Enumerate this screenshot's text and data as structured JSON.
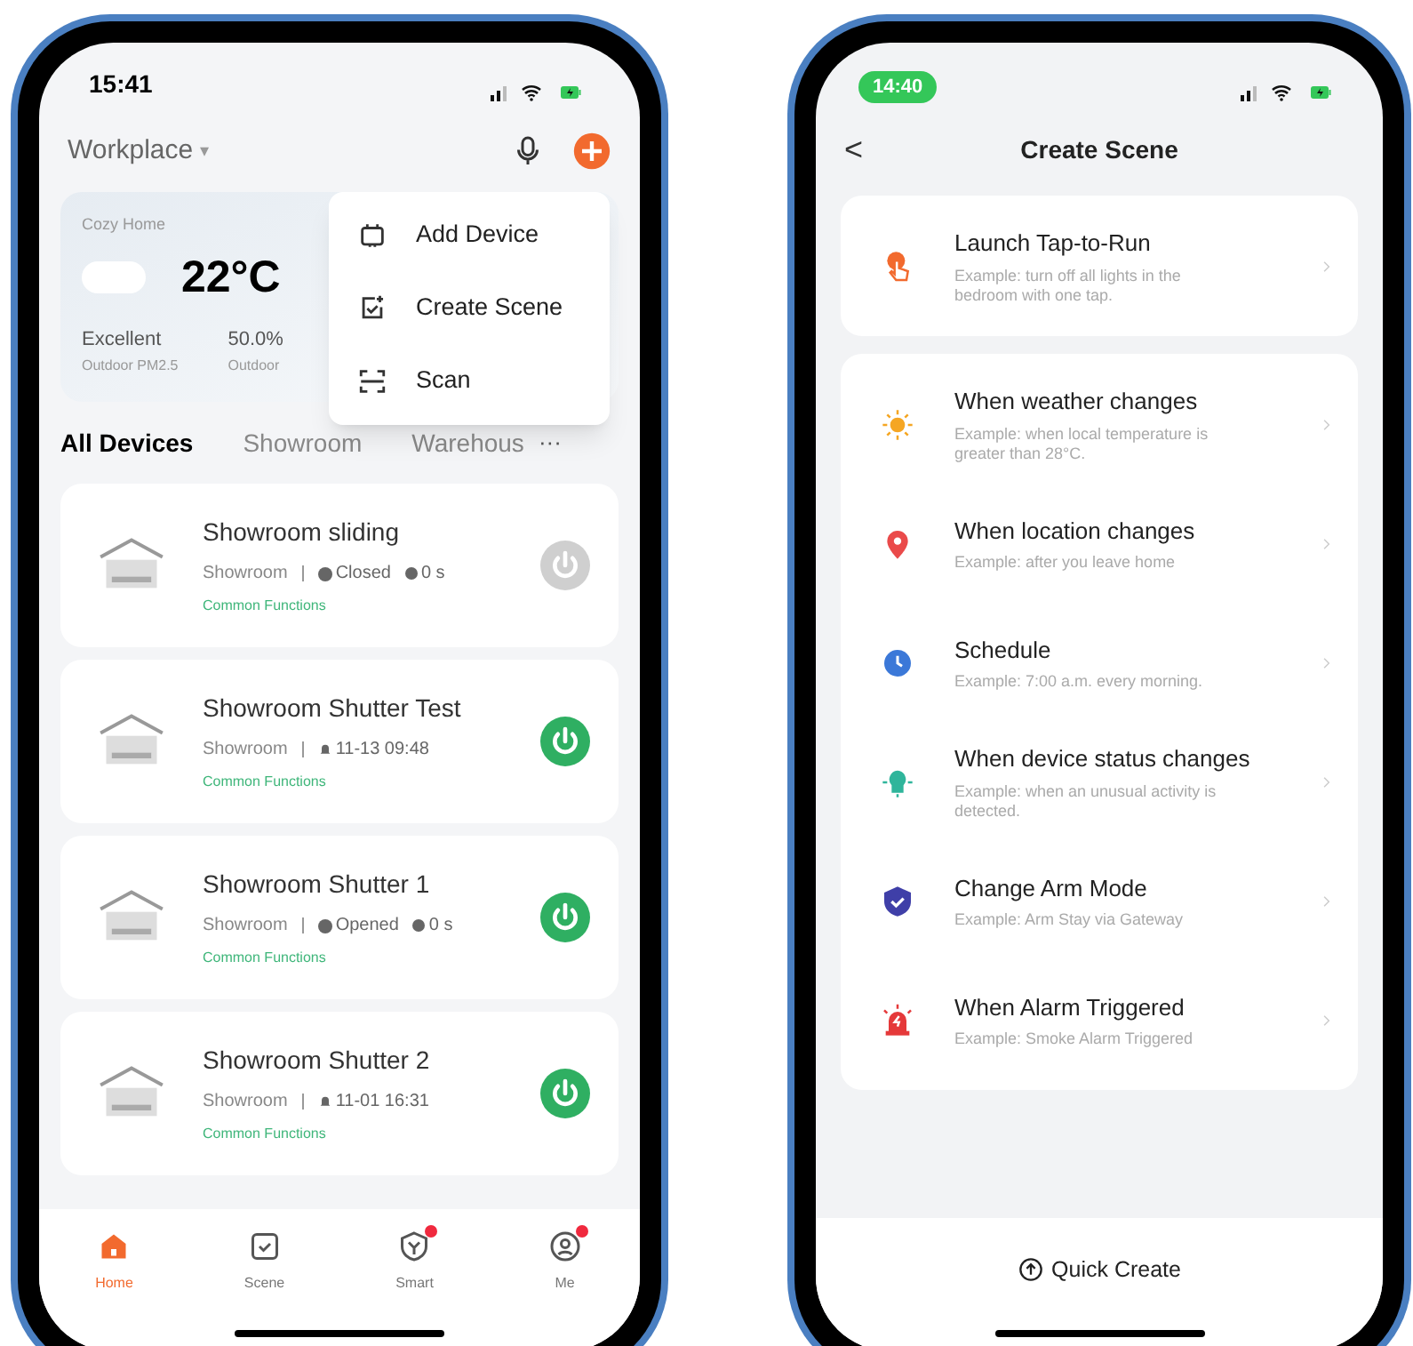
{
  "home_screen": {
    "status_bar": {
      "time": "15:41"
    },
    "header": {
      "title": "Workplace",
      "caret": "▾"
    },
    "weather": {
      "home": "Cozy Home",
      "temperature": "22°C",
      "stats": [
        {
          "value": "Excellent",
          "label": "Outdoor PM2.5"
        },
        {
          "value": "50.0%",
          "label": "Outdoor"
        }
      ]
    },
    "menu": {
      "items": [
        {
          "kind": "device",
          "label": "Add Device"
        },
        {
          "kind": "scene",
          "label": "Create Scene"
        },
        {
          "kind": "scan",
          "label": "Scan"
        }
      ]
    },
    "tabs": [
      {
        "label": "All Devices",
        "selected": true
      },
      {
        "label": "Showroom",
        "selected": false
      },
      {
        "label": "Warehous",
        "selected": false
      }
    ],
    "tabs_more": "···",
    "devices": [
      {
        "name": "Showroom sliding",
        "room": "Showroom",
        "status": "Closed",
        "duration": "0 s",
        "functions": "Common Functions",
        "on": false
      },
      {
        "name": "Showroom Shutter Test",
        "room": "Showroom",
        "timestamp": "11-13 09:48",
        "functions": "Common Functions",
        "on": true
      },
      {
        "name": "Showroom Shutter 1",
        "room": "Showroom",
        "status": "Opened",
        "duration": "0 s",
        "functions": "Common Functions",
        "on": true
      },
      {
        "name": "Showroom Shutter 2",
        "room": "Showroom",
        "timestamp": "11-01 16:31",
        "functions": "Common Functions",
        "on": true
      }
    ],
    "nav": [
      {
        "kind": "home",
        "label": "Home",
        "selected": true,
        "badge": false
      },
      {
        "kind": "scene",
        "label": "Scene",
        "selected": false,
        "badge": false
      },
      {
        "kind": "smart",
        "label": "Smart",
        "selected": false,
        "badge": true
      },
      {
        "kind": "me",
        "label": "Me",
        "selected": false,
        "badge": true
      }
    ]
  },
  "scene_screen": {
    "status_bar": {
      "time": "14:40"
    },
    "header": {
      "back": "<",
      "title": "Create Scene"
    },
    "sections": [
      {
        "items": [
          {
            "kind": "tap",
            "title": "Launch Tap-to-Run",
            "example": "Example: turn off all lights in the bedroom with one tap."
          }
        ]
      },
      {
        "items": [
          {
            "kind": "weather",
            "title": "When weather changes",
            "example": "Example: when local temperature is greater than 28°C."
          },
          {
            "kind": "location",
            "title": "When location changes",
            "example": "Example: after you leave home"
          },
          {
            "kind": "schedule",
            "title": "Schedule",
            "example": "Example: 7:00 a.m. every morning."
          },
          {
            "kind": "device",
            "title": "When device status changes",
            "example": "Example: when an unusual activity is detected."
          },
          {
            "kind": "arm",
            "title": "Change Arm Mode",
            "example": "Example: Arm Stay via Gateway"
          },
          {
            "kind": "alarm",
            "title": "When Alarm Triggered",
            "example": "Example: Smoke Alarm Triggered"
          }
        ]
      }
    ],
    "quick_create": "Quick Create"
  }
}
